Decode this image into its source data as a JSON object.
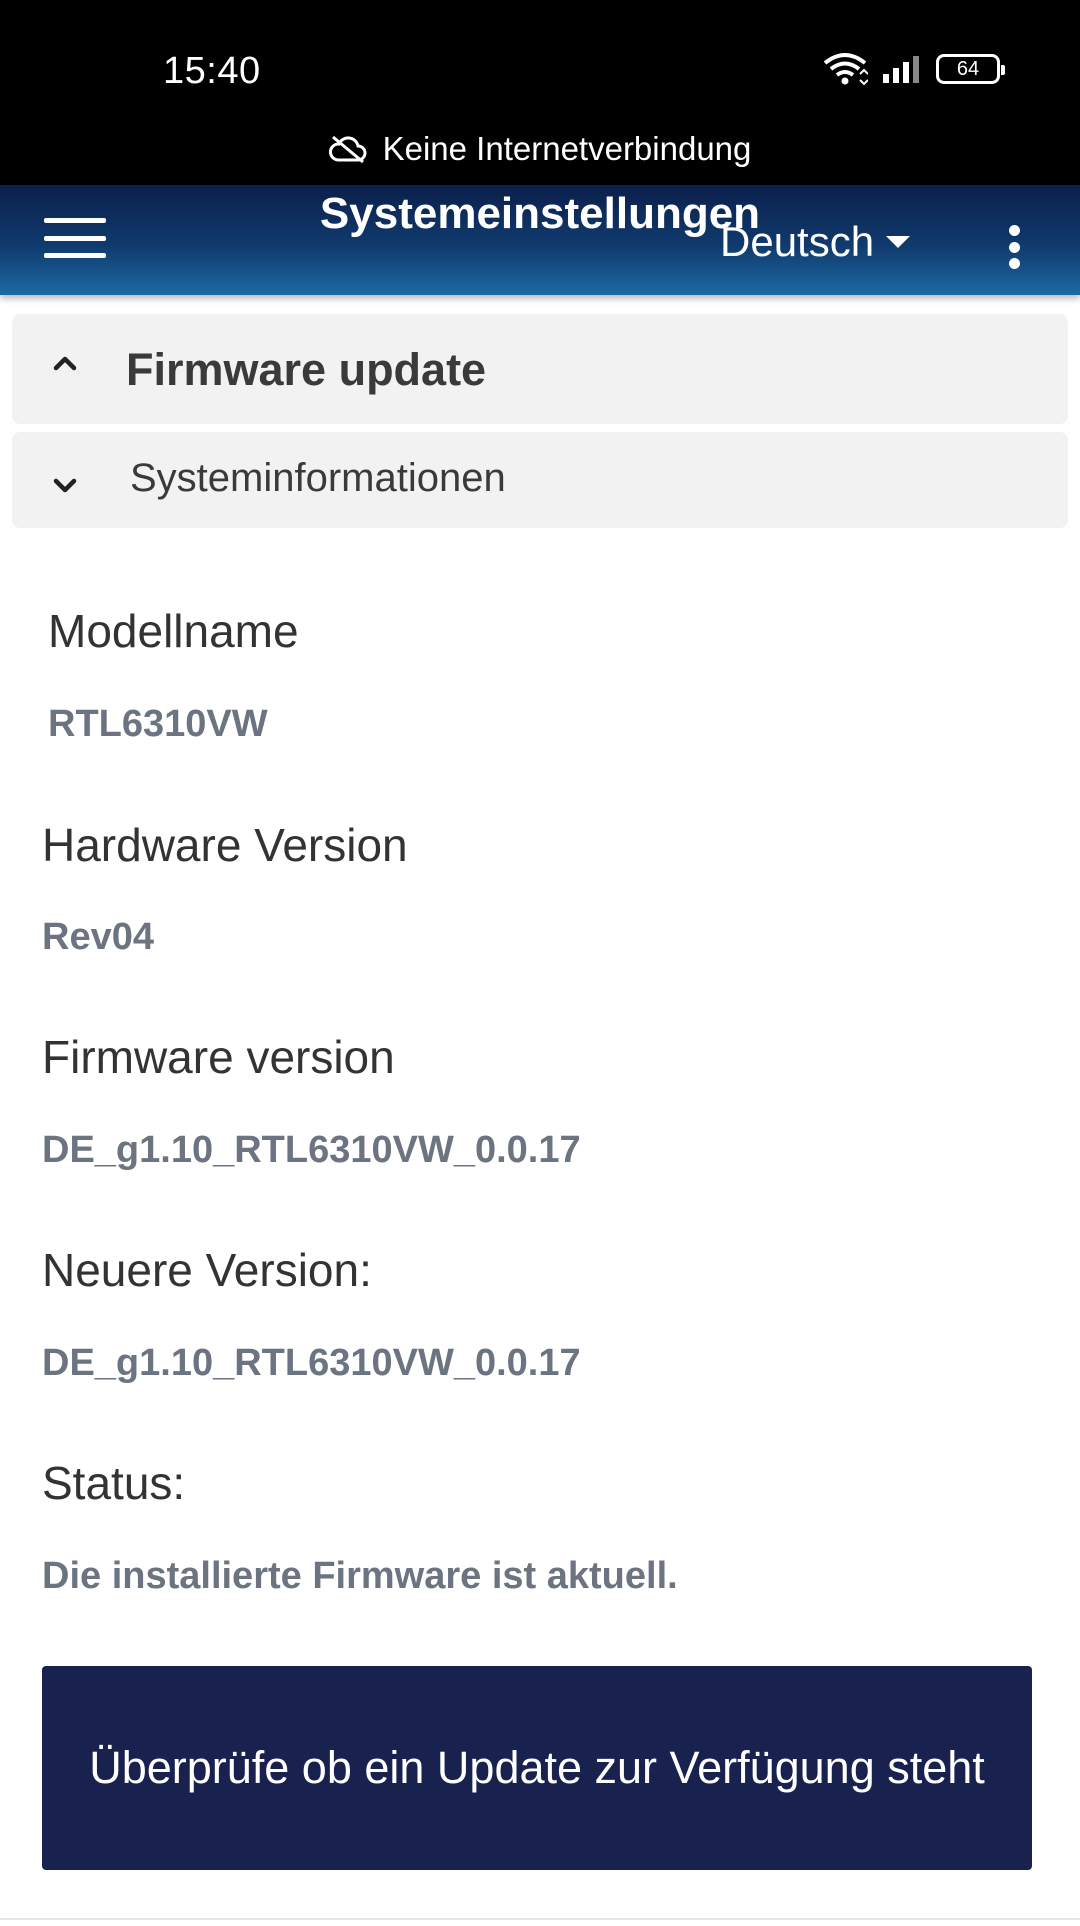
{
  "status_bar": {
    "time": "15:40",
    "battery": "64",
    "offline_text": "Keine Internetverbindung"
  },
  "app_bar": {
    "title": "Systemeinstellungen",
    "language": "Deutsch"
  },
  "sections": {
    "firmware_update": "Firmware update",
    "system_info": "Systeminformationen"
  },
  "fields": [
    {
      "label": "Modellname",
      "value": "RTL6310VW"
    },
    {
      "label": "Hardware Version",
      "value": "Rev04"
    },
    {
      "label": "Firmware version",
      "value": "DE_g1.10_RTL6310VW_0.0.17"
    },
    {
      "label": "Neuere Version:",
      "value": "DE_g1.10_RTL6310VW_0.0.17"
    },
    {
      "label": "Status:",
      "value": "Die installierte Firmware ist aktuell."
    }
  ],
  "actions": {
    "check_update": "Überprüfe ob ein Update zur Verfügung steht"
  },
  "colors": {
    "app_bar_top": "#0b1f4b",
    "app_bar_bottom": "#1c6aa4",
    "button": "#19214f",
    "value_text": "#6b7480"
  }
}
